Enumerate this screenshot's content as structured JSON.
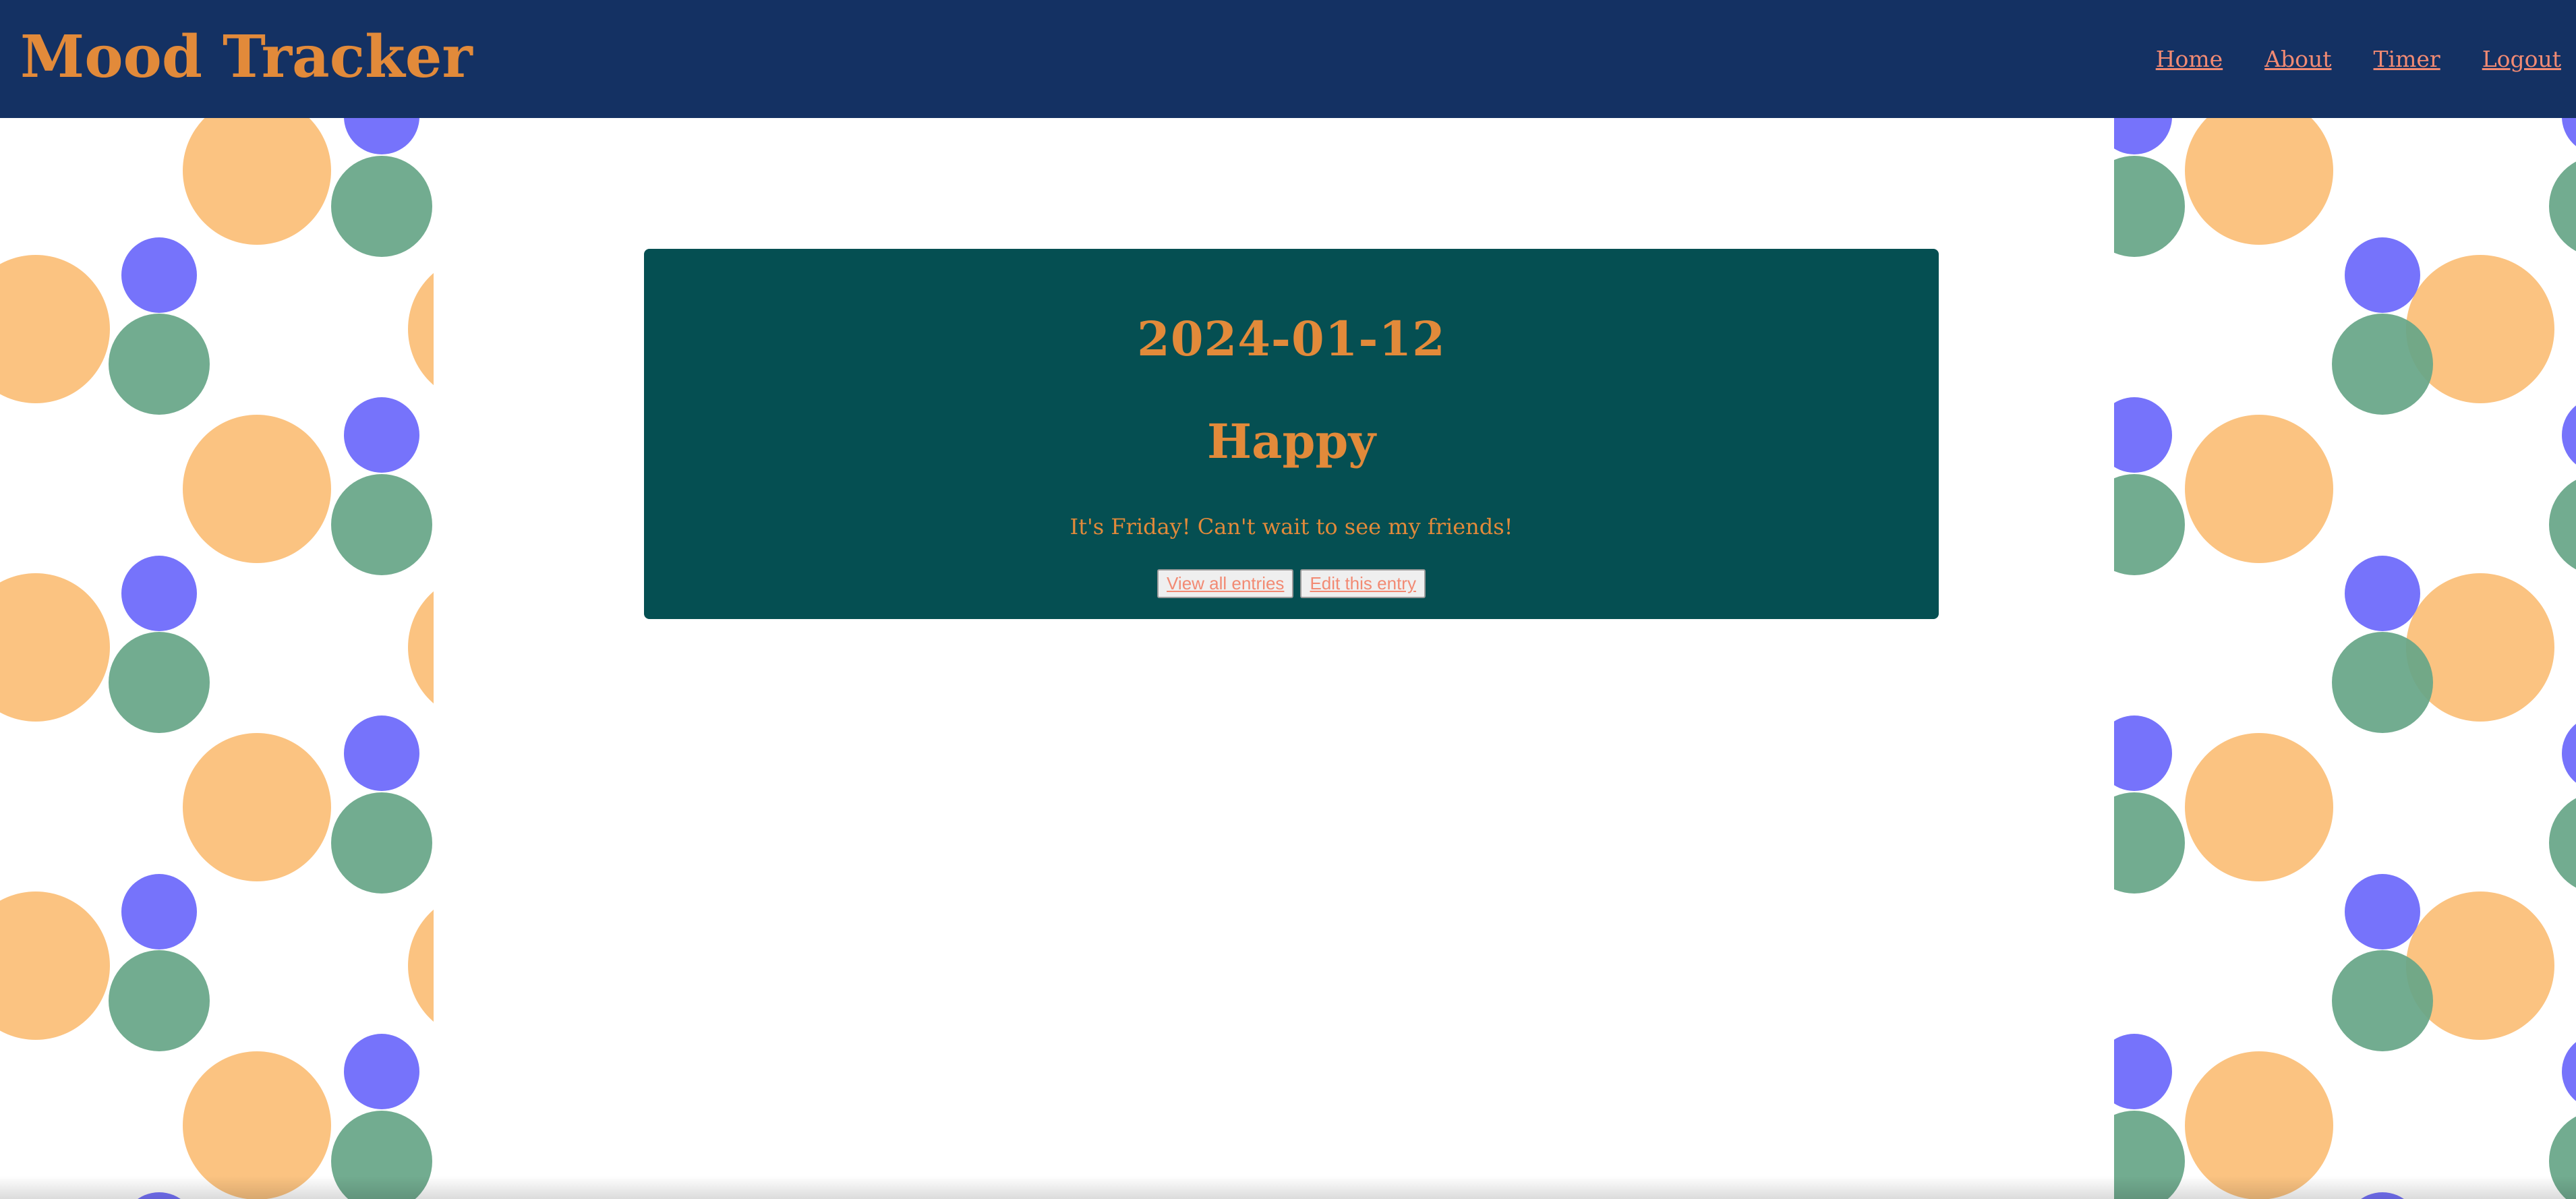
{
  "header": {
    "title": "Mood Tracker",
    "nav": [
      "Home",
      "About",
      "Timer",
      "Logout"
    ]
  },
  "entry": {
    "date": "2024-01-12",
    "mood": "Happy",
    "note": "It's Friday! Can't wait to see my friends!",
    "actions": {
      "view_all": "View all entries",
      "edit": "Edit this entry"
    }
  },
  "colors": {
    "header_bg": "#143163",
    "accent_orange": "#E28A3A",
    "link_salmon": "#F28A73",
    "card_bg": "#054F52",
    "pattern_peach": "#FBBE77",
    "pattern_blue": "#6A67FB",
    "pattern_green": "#66A587"
  }
}
